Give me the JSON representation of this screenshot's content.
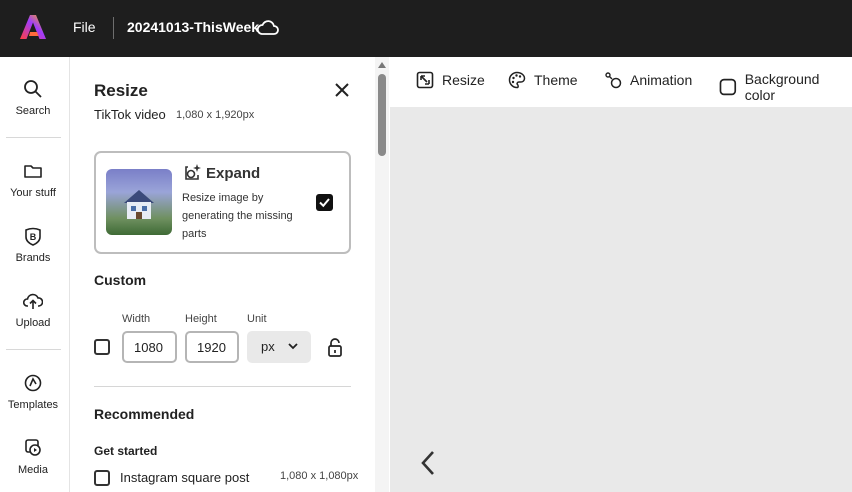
{
  "header": {
    "file_label": "File",
    "doc_title": "20241013-ThisWeek",
    "brand_colors": [
      "#ff3e3e",
      "#a03cff",
      "#ffb400"
    ]
  },
  "leftnav": {
    "items": [
      {
        "label": "Search",
        "icon": "search-icon"
      },
      {
        "label": "Your stuff",
        "icon": "folder-icon"
      },
      {
        "label": "Brands",
        "icon": "brand-icon"
      },
      {
        "label": "Upload",
        "icon": "upload-cloud-icon"
      },
      {
        "label": "Templates",
        "icon": "templates-icon"
      },
      {
        "label": "Media",
        "icon": "media-icon"
      }
    ]
  },
  "panel": {
    "title": "Resize",
    "preset_name": "TikTok video",
    "preset_size": "1,080 x 1,920px",
    "expand": {
      "title": "Expand",
      "description": "Resize image by generating the missing parts",
      "checked": true
    },
    "custom": {
      "title": "Custom",
      "width_label": "Width",
      "height_label": "Height",
      "unit_label": "Unit",
      "width_value": "1080",
      "height_value": "1920",
      "unit_value": "px"
    },
    "recommended": {
      "title": "Recommended",
      "group_title": "Get started",
      "items": [
        {
          "label": "Instagram square post",
          "size": "1,080 x 1,080px"
        }
      ]
    }
  },
  "toolbar": {
    "resize_label": "Resize",
    "theme_label": "Theme",
    "animation_label": "Animation",
    "background_label": "Background color"
  }
}
